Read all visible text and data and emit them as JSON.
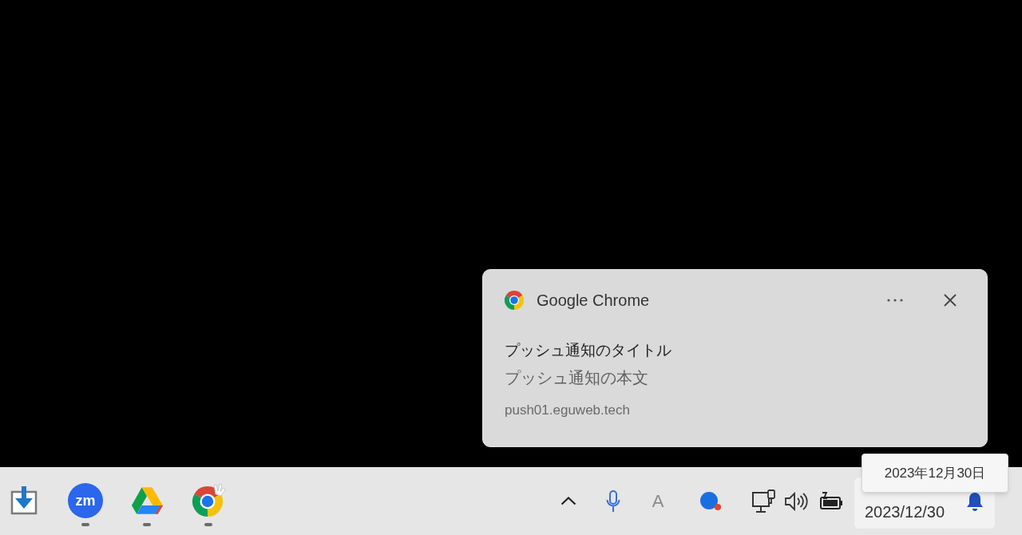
{
  "notification": {
    "app_name": "Google Chrome",
    "title": "プッシュ通知のタイトル",
    "body": "プッシュ通知の本文",
    "source": "push01.eguweb.tech"
  },
  "taskbar": {
    "apps": [
      {
        "kind": "download",
        "running": false
      },
      {
        "kind": "meeting",
        "label": "zm",
        "running": true
      },
      {
        "kind": "drive",
        "running": true
      },
      {
        "kind": "browser",
        "running": true
      }
    ],
    "tray": {
      "ime": {
        "label": "A",
        "disabled": true
      }
    },
    "clock": {
      "date": "2023/12/30"
    },
    "tooltip": "2023年12月30日"
  }
}
